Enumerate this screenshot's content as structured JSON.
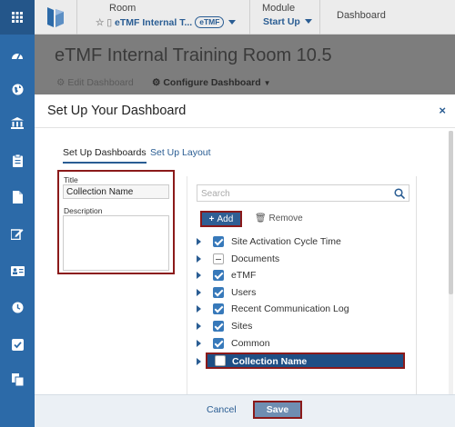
{
  "sidebar": {
    "icons": [
      "grid-icon",
      "dashboard-gauge-icon",
      "globe-icon",
      "bank-icon",
      "clipboard-icon",
      "document-icon",
      "edit-icon",
      "id-card-icon",
      "clock-icon",
      "checkbox-icon",
      "files-icon"
    ]
  },
  "header": {
    "room_label": "Room",
    "room_value": "eTMF Internal T...",
    "room_badge": "eTMF",
    "module_label": "Module",
    "module_value": "Start Up",
    "breadcrumb": "Dashboard"
  },
  "page": {
    "title": "eTMF Internal Training Room 10.5",
    "edit_label": "Edit Dashboard",
    "configure_label": "Configure Dashboard"
  },
  "modal": {
    "title": "Set Up Your Dashboard",
    "close": "×",
    "tabs": [
      "Set Up Dashboards",
      "Set Up Layout"
    ],
    "title_label": "Title",
    "title_value": "Collection Name",
    "description_label": "Description",
    "search_placeholder": "Search",
    "add_label": "Add",
    "remove_label": "Remove",
    "tree": [
      {
        "label": "Site Activation Cycle Time",
        "state": "checked"
      },
      {
        "label": "Documents",
        "state": "partial"
      },
      {
        "label": "eTMF",
        "state": "checked"
      },
      {
        "label": "Users",
        "state": "checked"
      },
      {
        "label": "Recent Communication Log",
        "state": "checked"
      },
      {
        "label": "Sites",
        "state": "checked"
      },
      {
        "label": "Common",
        "state": "checked"
      },
      {
        "label": "Collection Name",
        "state": "unchecked",
        "selected": true
      }
    ],
    "cancel_label": "Cancel",
    "save_label": "Save"
  },
  "colors": {
    "sidebar": "#2c6aa8",
    "accent": "#2a5d93",
    "highlight_border": "#8b1a1a",
    "selected_row": "#1f4f85"
  }
}
